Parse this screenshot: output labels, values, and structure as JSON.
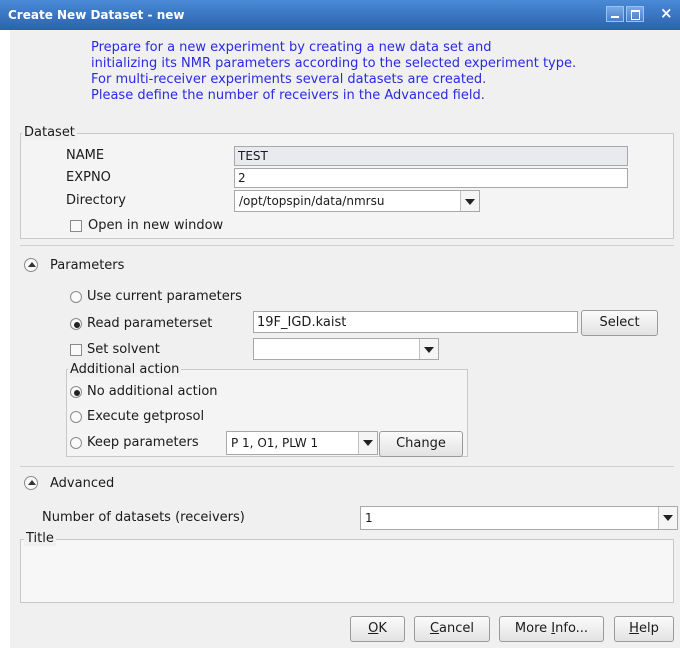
{
  "window": {
    "title": "Create New Dataset - new",
    "close_glyph": "×"
  },
  "intro": {
    "lines": [
      "Prepare for a new experiment by creating a new data set and",
      "initializing its NMR parameters according to the selected experiment type.",
      "For multi-receiver experiments several datasets are created.",
      "Please define the number of receivers in the Advanced field."
    ]
  },
  "dataset": {
    "legend": "Dataset",
    "name_label": "NAME",
    "name_value": "TEST",
    "expno_label": "EXPNO",
    "expno_value": "2",
    "directory_label": "Directory",
    "directory_value": "/opt/topspin/data/nmrsu",
    "open_new_window_label": "Open in new window"
  },
  "parameters": {
    "header": "Parameters",
    "use_current_label": "Use current parameters",
    "read_parameterset_label": "Read parameterset",
    "parameterset_value": "19F_IGD.kaist",
    "select_button": "Select",
    "set_solvent_label": "Set solvent",
    "solvent_value": "",
    "additional_action": {
      "legend": "Additional action",
      "no_action_label": "No additional action",
      "execute_getprosol_label": "Execute getprosol",
      "keep_parameters_label": "Keep parameters",
      "keep_parameters_value": "P 1, O1, PLW 1",
      "change_button": "Change"
    }
  },
  "advanced": {
    "header": "Advanced",
    "num_datasets_label": "Number of datasets (receivers)",
    "num_datasets_value": "1"
  },
  "title_section": {
    "legend": "Title"
  },
  "footer": {
    "ok_first": "O",
    "ok_rest": "K",
    "cancel_first": "C",
    "cancel_rest": "ancel",
    "more_info_pre": "More ",
    "more_info_u": "I",
    "more_info_post": "nfo...",
    "help_first": "H",
    "help_rest": "elp"
  }
}
